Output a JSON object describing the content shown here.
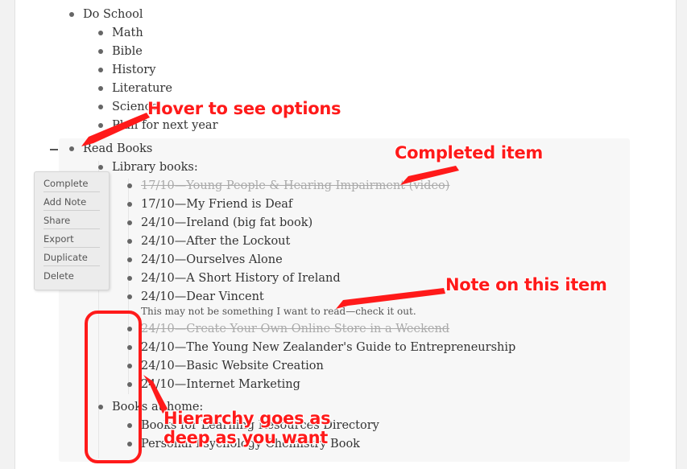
{
  "outline": {
    "do_school": "Do School",
    "do_school_children": [
      "Math",
      "Bible",
      "History",
      "Literature",
      "Science",
      "Plan for next year"
    ],
    "read_books": "Read Books",
    "library_books": "Library books:",
    "library_items": [
      "17/10—Young People & Hearing Impairment (video)",
      "17/10—My Friend is Deaf",
      "24/10—Ireland (big fat book)",
      "24/10—After the Lockout",
      "24/10—Ourselves Alone",
      "24/10—A Short History of Ireland",
      "24/10—Dear Vincent",
      "24/10—Create Your Own Online Store in a Weekend",
      "24/10—The Young New Zealander's Guide to Entrepreneurship",
      "24/10—Basic Website Creation",
      "24/10—Internet Marketing"
    ],
    "dear_vincent_note": "This may not be something I want to read—check it out.",
    "books_at_home": "Books at home:",
    "home_items": [
      "Books for Learning Resources Directory",
      "Personal Psychology Chemistry Book"
    ]
  },
  "menu": {
    "complete": "Complete",
    "add_note": "Add Note",
    "share": "Share",
    "export": "Export",
    "duplicate": "Duplicate",
    "delete": "Delete"
  },
  "callouts": {
    "hover": "Hover to see options",
    "completed": "Completed item",
    "note": "Note on this item",
    "hierarchy_line1": "Hierarchy goes as",
    "hierarchy_line2": "deep as you want"
  },
  "colors": {
    "annotation": "#ff1a1a",
    "completed_text": "#aaaaaa"
  }
}
